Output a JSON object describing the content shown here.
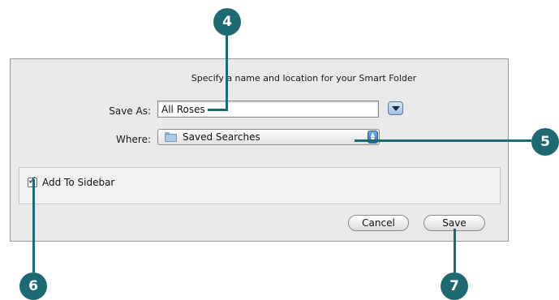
{
  "dialog": {
    "instruction": "Specify a name and location for your Smart Folder",
    "save_as_label": "Save As:",
    "save_as_value": "All Roses",
    "where_label": "Where:",
    "where_value": "Saved Searches",
    "add_to_sidebar_label": "Add To Sidebar",
    "add_to_sidebar_checked": true,
    "cancel_label": "Cancel",
    "save_label": "Save"
  },
  "callouts": {
    "c4": "4",
    "c5": "5",
    "c6": "6",
    "c7": "7"
  },
  "colors": {
    "callout": "#1e6a73",
    "dialog_bg": "#e9e9e9"
  },
  "icons": {
    "expand": "disclosure-triangle-icon",
    "folder": "folder-icon",
    "stepper": "updown-stepper-icon",
    "checkbox": "checkmark-icon"
  }
}
